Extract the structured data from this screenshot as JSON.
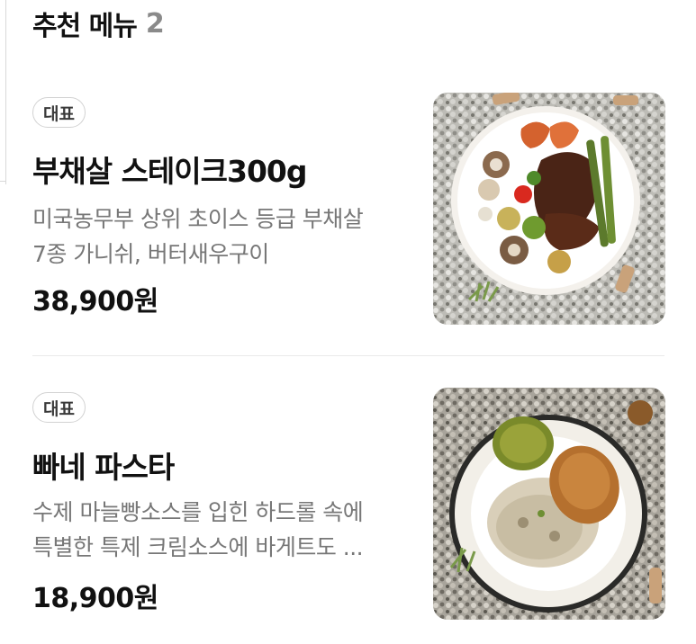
{
  "section": {
    "title": "추천 메뉴",
    "count": "2"
  },
  "menu": [
    {
      "badge": "대표",
      "name": "부채살 스테이크300g",
      "desc_lines": [
        "미국농무부 상위 초이스 등급 부채살",
        "7종 가니쉬, 버터새우구이"
      ],
      "price": "38,900원",
      "image_icon": "steak-plate-photo"
    },
    {
      "badge": "대표",
      "name": "빠네 파스타",
      "desc_lines": [
        "수제 마늘빵소스를 입힌 하드롤 속에",
        "특별한 특제 크림소스에 바게트도 ..."
      ],
      "price": "18,900원",
      "image_icon": "pasta-bread-bowl-photo"
    }
  ],
  "colors": {
    "text": "#111111",
    "muted": "#777777",
    "badge_border": "#d2d2d2",
    "divider": "#e9e9e9"
  }
}
